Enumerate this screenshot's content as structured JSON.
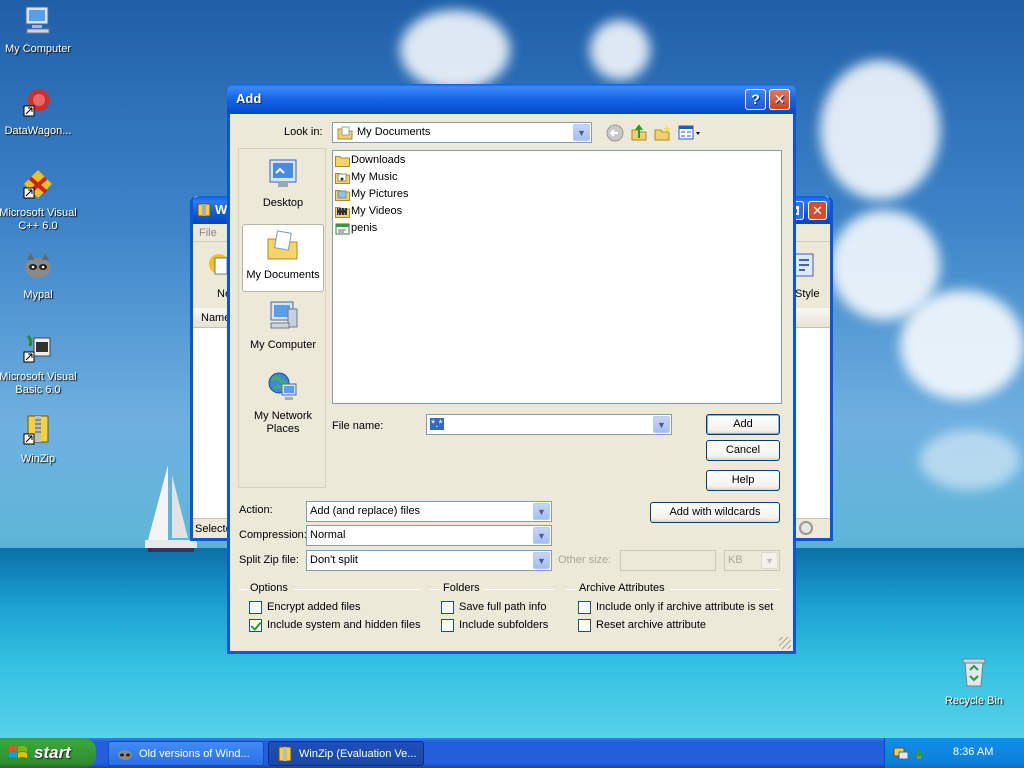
{
  "desktop": {
    "icons": [
      {
        "label": "My Computer"
      },
      {
        "label": "DataWagon..."
      },
      {
        "label": "Microsoft Visual C++ 6.0"
      },
      {
        "label": "Mypal"
      },
      {
        "label": "Microsoft Visual Basic 6.0"
      },
      {
        "label": "WinZip"
      },
      {
        "label": "Recycle Bin"
      }
    ]
  },
  "background_window": {
    "title_initial": "W",
    "menu_file": "File",
    "toolbar_left": "Ne",
    "toolbar_right": "Style",
    "column_name": "Name",
    "status": "Selecte"
  },
  "dialog": {
    "title": "Add",
    "help_glyph": "?",
    "close_glyph": "✕",
    "look_in_label": "Look in:",
    "look_in_value": "My Documents",
    "places": [
      {
        "label": "Desktop"
      },
      {
        "label": "My Documents"
      },
      {
        "label": "My Computer"
      },
      {
        "label": "My Network Places"
      }
    ],
    "files": [
      {
        "name": "Downloads"
      },
      {
        "name": "My Music"
      },
      {
        "name": "My Pictures"
      },
      {
        "name": "My Videos"
      },
      {
        "name": "penis"
      }
    ],
    "file_name_label": "File name:",
    "file_name_value": "*.*",
    "buttons": {
      "add": "Add",
      "cancel": "Cancel",
      "help": "Help",
      "add_wildcards": "Add with wildcards"
    },
    "action_label": "Action:",
    "action_value": "Add (and replace) files",
    "compression_label": "Compression:",
    "compression_value": "Normal",
    "split_label": "Split Zip file:",
    "split_value": "Don't split",
    "other_size_label": "Other size:",
    "other_size_value": "",
    "unit_value": "KB",
    "groups": {
      "options": "Options",
      "folders": "Folders",
      "archive": "Archive Attributes"
    },
    "checks": {
      "encrypt": {
        "label": "Encrypt added files",
        "checked": false
      },
      "include_hidden": {
        "label": "Include system and hidden files",
        "checked": true
      },
      "full_path": {
        "label": "Save full path info",
        "checked": false
      },
      "subfolders": {
        "label": "Include subfolders",
        "checked": false
      },
      "archive_only": {
        "label": "Include only if archive attribute is set",
        "checked": false
      },
      "reset_archive": {
        "label": "Reset archive attribute",
        "checked": false
      }
    }
  },
  "taskbar": {
    "start": "start",
    "tasks": [
      {
        "label": "Old versions of Wind..."
      },
      {
        "label": "WinZip (Evaluation Ve..."
      }
    ],
    "clock": "8:36 AM"
  }
}
